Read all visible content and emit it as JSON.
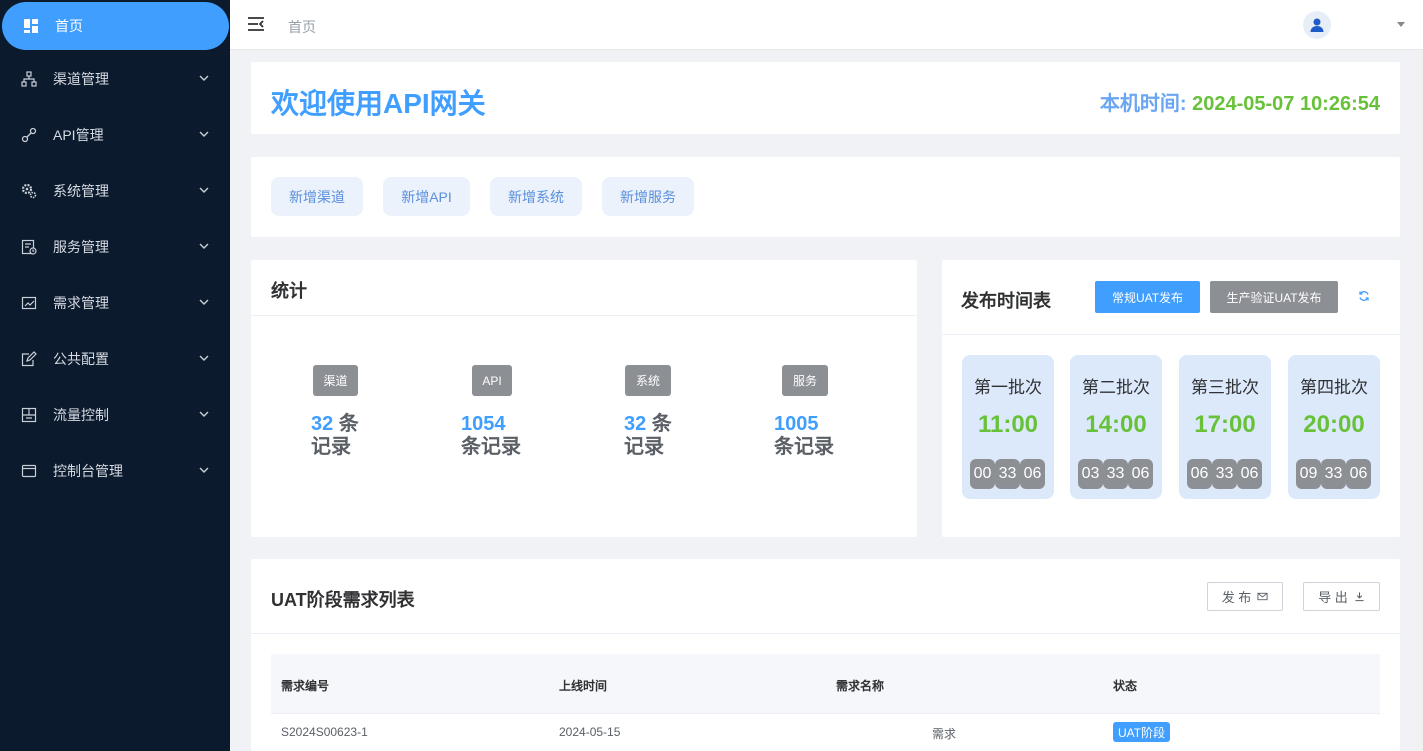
{
  "sidebar": {
    "items": [
      {
        "label": "首页",
        "icon": "dashboard-icon"
      },
      {
        "label": "渠道管理",
        "icon": "channel-tree-icon"
      },
      {
        "label": "API管理",
        "icon": "link-icon"
      },
      {
        "label": "系统管理",
        "icon": "gear-icon"
      },
      {
        "label": "服务管理",
        "icon": "service-doc-icon"
      },
      {
        "label": "需求管理",
        "icon": "demand-chart-icon"
      },
      {
        "label": "公共配置",
        "icon": "edit-config-icon"
      },
      {
        "label": "流量控制",
        "icon": "traffic-grid-icon"
      },
      {
        "label": "控制台管理",
        "icon": "console-window-icon"
      }
    ]
  },
  "header": {
    "breadcrumb": "首页",
    "user_icon": "user-avatar-icon"
  },
  "welcome": {
    "title": "欢迎使用API网关",
    "clock_label": "本机时间: ",
    "clock_value": "2024-05-07 10:26:54"
  },
  "quick_actions": [
    "新增渠道",
    "新增API",
    "新增系统",
    "新增服务"
  ],
  "stats": {
    "title": "统计",
    "items": [
      {
        "tag": "渠道",
        "count": "32",
        "unit_a": " 条",
        "unit_b": "记录"
      },
      {
        "tag": "API",
        "count": "1054",
        "unit_a": "",
        "unit_b": "条记录"
      },
      {
        "tag": "系统",
        "count": "32",
        "unit_a": " 条",
        "unit_b": "记录"
      },
      {
        "tag": "服务",
        "count": "1005",
        "unit_a": "",
        "unit_b": "条记录"
      }
    ]
  },
  "schedule": {
    "title": "发布时间表",
    "btn_regular": "常规UAT发布",
    "btn_prod": "生产验证UAT发布",
    "batches": [
      {
        "name": "第一批次",
        "time": "11:00",
        "countdown": [
          "00",
          "33",
          "06"
        ]
      },
      {
        "name": "第二批次",
        "time": "14:00",
        "countdown": [
          "03",
          "33",
          "06"
        ]
      },
      {
        "name": "第三批次",
        "time": "17:00",
        "countdown": [
          "06",
          "33",
          "06"
        ]
      },
      {
        "name": "第四批次",
        "time": "20:00",
        "countdown": [
          "09",
          "33",
          "06"
        ]
      }
    ]
  },
  "uat": {
    "title": "UAT阶段需求列表",
    "btn_publish": "发 布",
    "btn_export": "导 出",
    "columns": [
      "需求编号",
      "上线时间",
      "需求名称",
      "状态"
    ],
    "rows": [
      {
        "id": "S2024S00623-1",
        "date": "2024-05-15",
        "name": "需求",
        "status": "UAT阶段"
      }
    ]
  },
  "colors": {
    "accent": "#409eff",
    "sidebar_bg": "#0b1a2c",
    "success": "#67c23a",
    "tag_gray": "#8c8f94"
  }
}
